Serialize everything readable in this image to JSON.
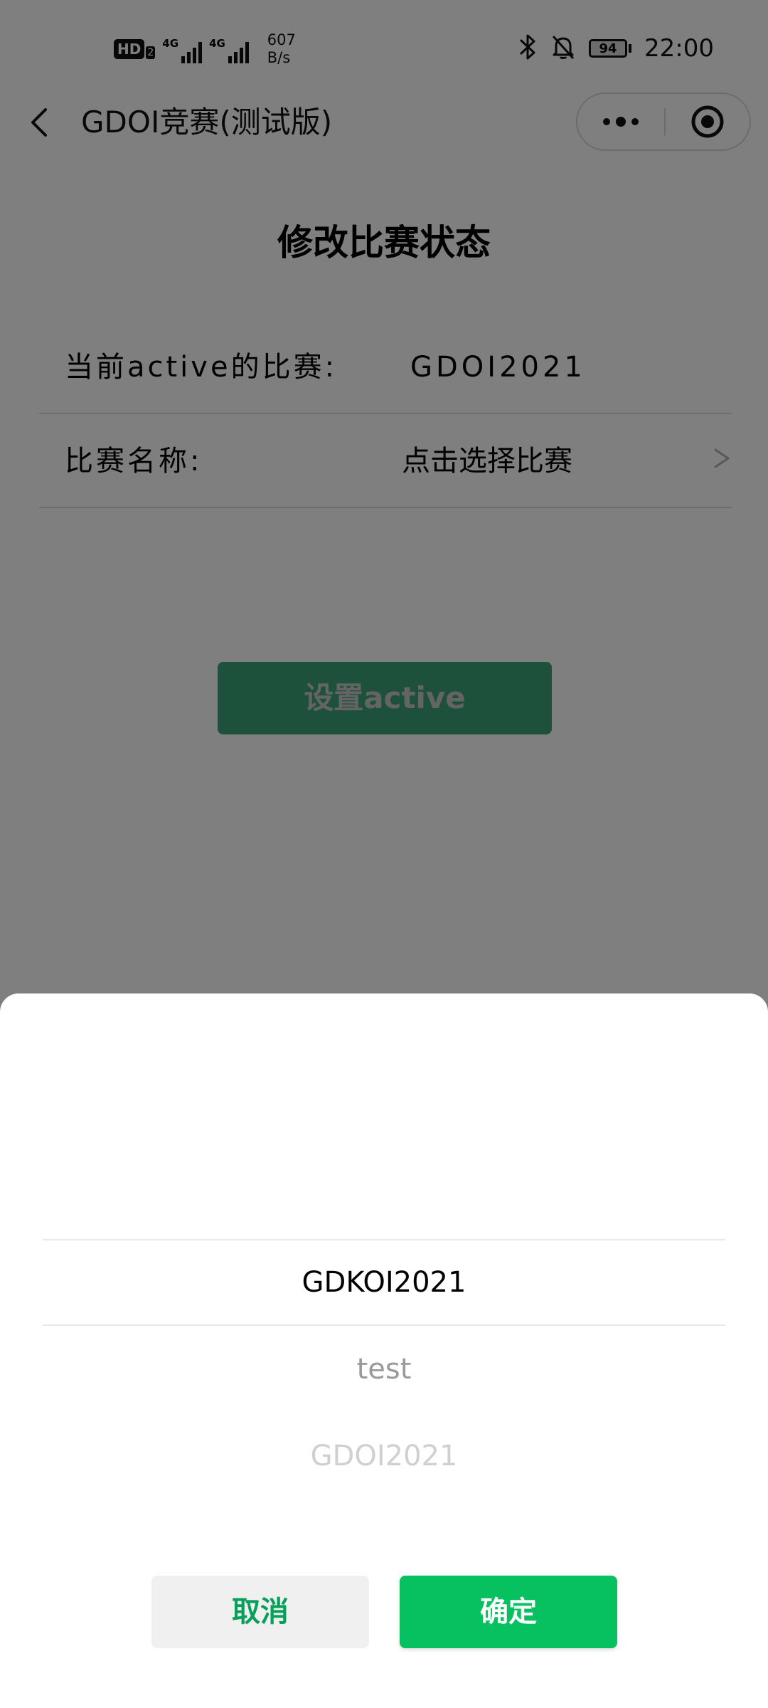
{
  "status_bar": {
    "hd_label": "HD",
    "hd_sub": "2",
    "network_1": "4G",
    "network_2": "4G",
    "speed_value": "607",
    "speed_unit": "B/s",
    "battery_level": "94",
    "time": "22:00",
    "icons": [
      "bluetooth-icon",
      "bell-off-icon",
      "battery-icon"
    ]
  },
  "nav": {
    "title": "GDOI竞赛(测试版)",
    "back_icon": "chevron-left-icon",
    "more_icon": "more-dots-icon",
    "close_icon": "target-circle-icon"
  },
  "main": {
    "title": "修改比赛状态",
    "rows": [
      {
        "label": "当前active的比赛:",
        "value": "GDOI2021"
      },
      {
        "label": "比赛名称:",
        "value": "点击选择比赛",
        "chevron": ">"
      }
    ],
    "set_active_button": "设置active"
  },
  "picker": {
    "options": [
      "GDKOI2021",
      "test",
      "GDOI2021"
    ],
    "selected_index": 0,
    "cancel_label": "取消",
    "confirm_label": "确定"
  },
  "colors": {
    "accent_green": "#07c160",
    "mask": "rgba(0,0,0,0.5)"
  }
}
